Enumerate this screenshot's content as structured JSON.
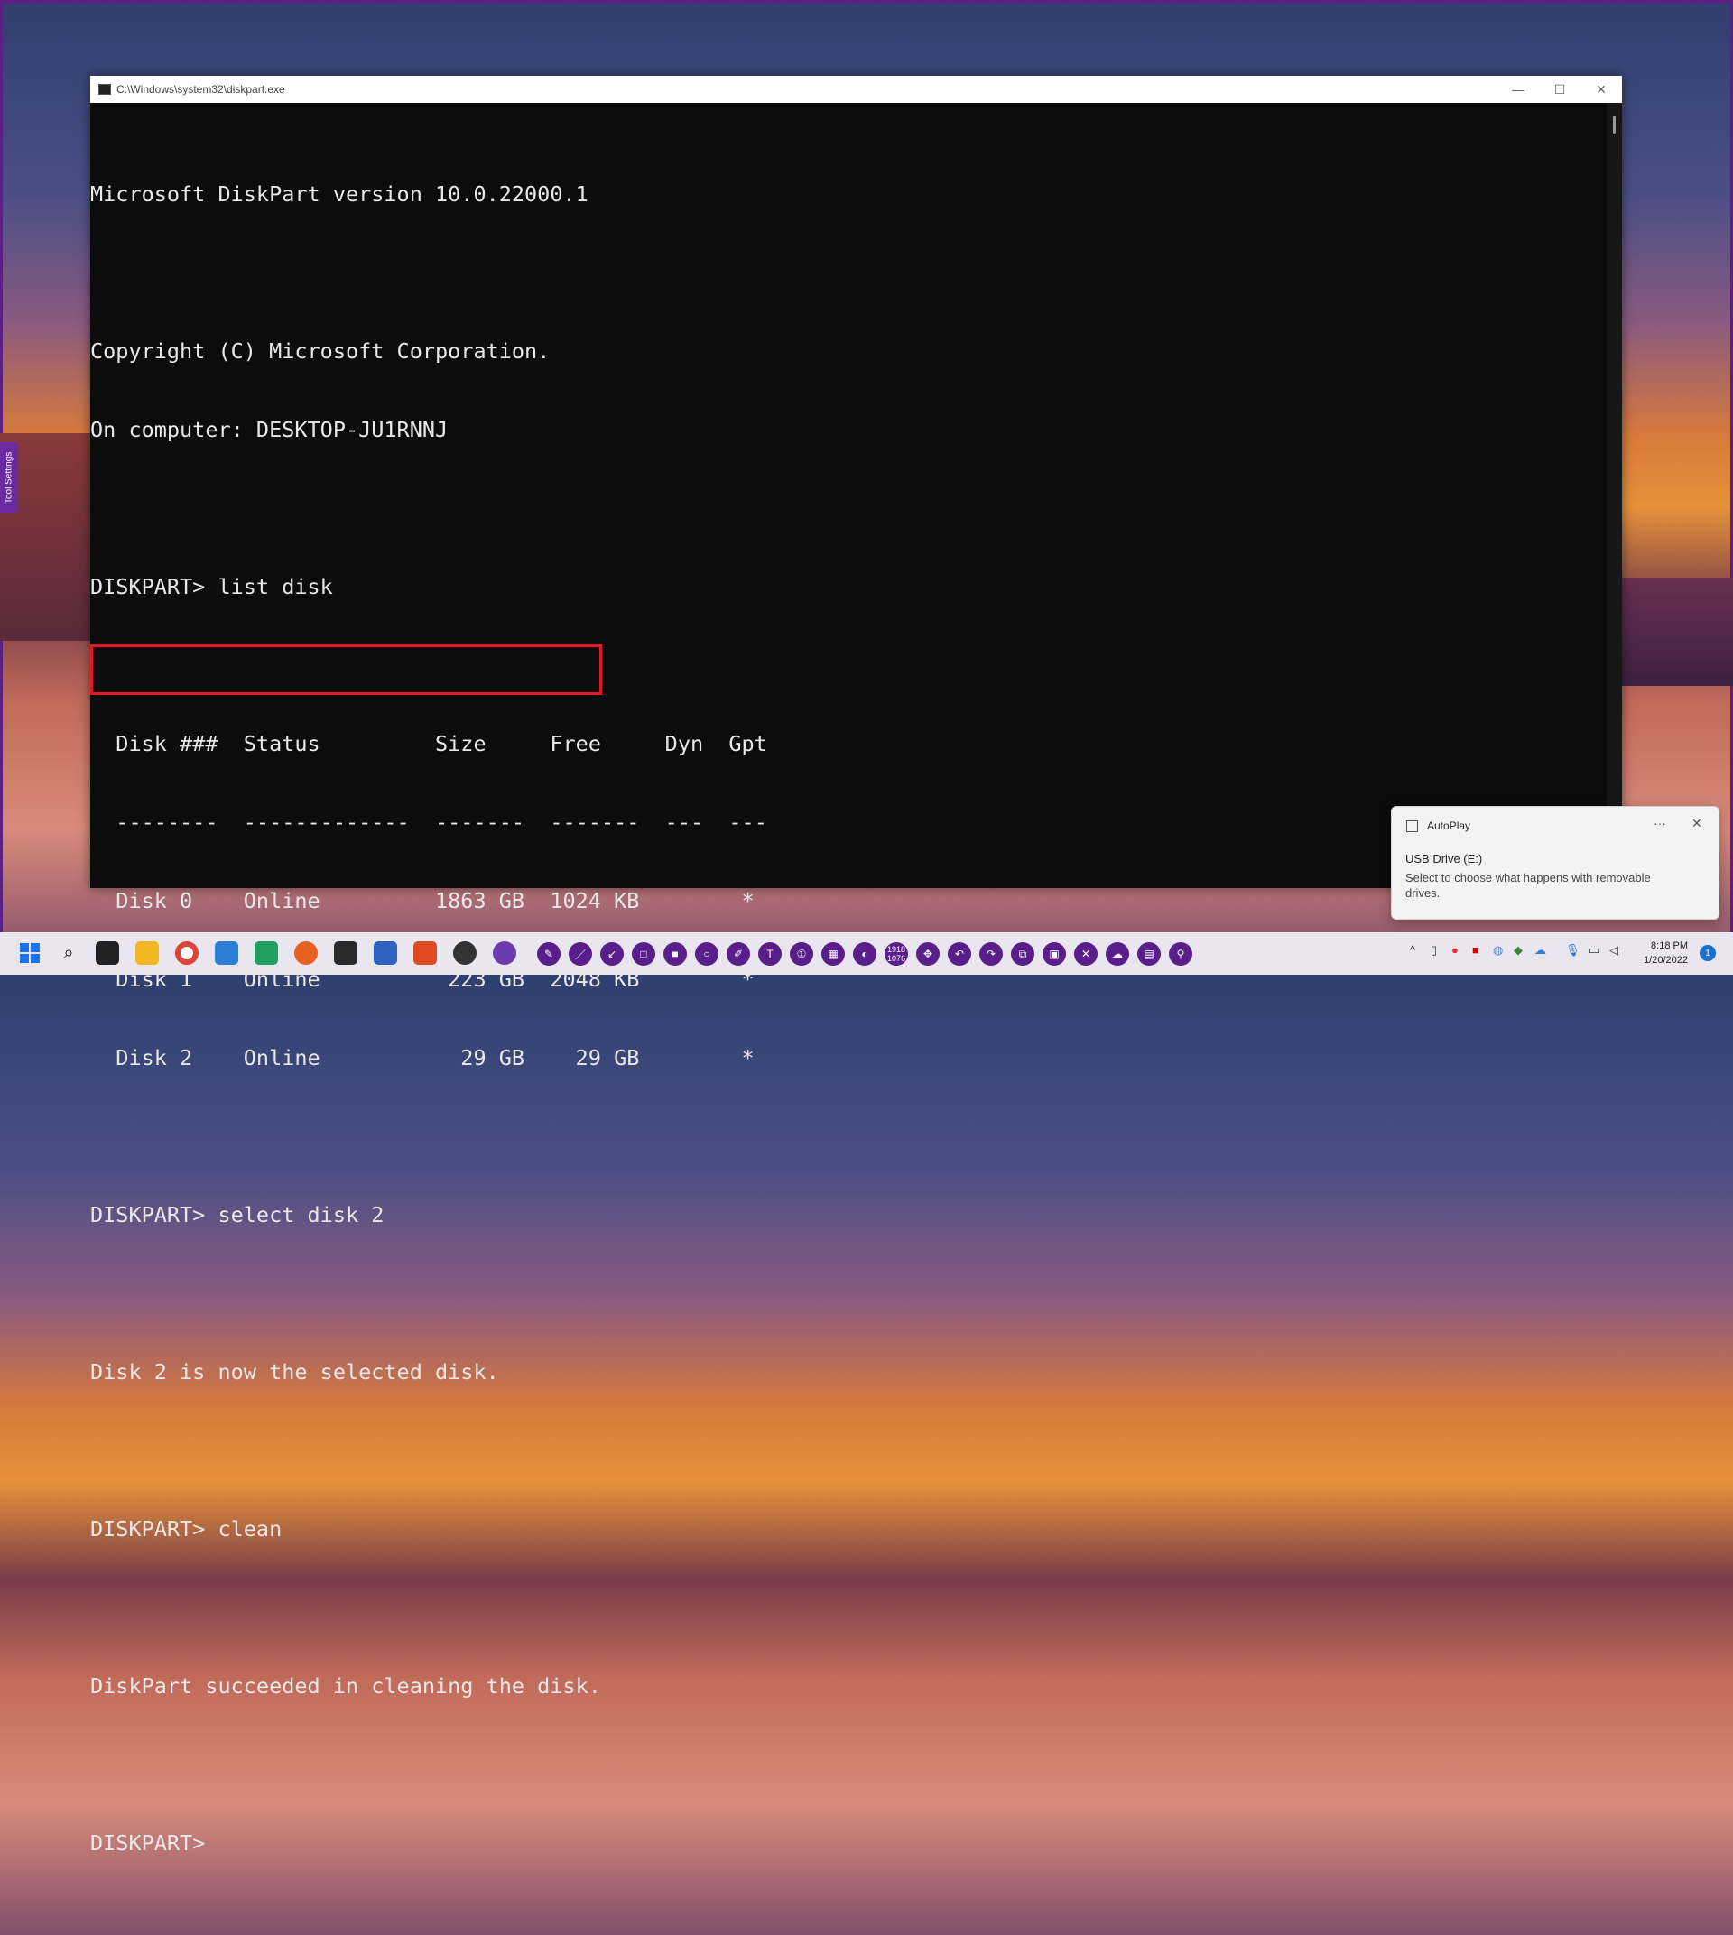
{
  "window": {
    "title": "C:\\Windows\\system32\\diskpart.exe",
    "minimize": "—",
    "maximize": "☐",
    "close": "✕"
  },
  "console": {
    "lines": [
      "Microsoft DiskPart version 10.0.22000.1",
      "",
      "Copyright (C) Microsoft Corporation.",
      "On computer: DESKTOP-JU1RNNJ",
      "",
      "DISKPART> list disk",
      "",
      "  Disk ###  Status         Size     Free     Dyn  Gpt",
      "  --------  -------------  -------  -------  ---  ---",
      "  Disk 0    Online         1863 GB  1024 KB        *",
      "  Disk 1    Online          223 GB  2048 KB        *",
      "  Disk 2    Online           29 GB    29 GB        *",
      "",
      "DISKPART> select disk 2",
      "",
      "Disk 2 is now the selected disk.",
      "",
      "DISKPART> clean",
      "",
      "DiskPart succeeded in cleaning the disk.",
      "",
      "DISKPART> "
    ]
  },
  "side_panel": {
    "label": "Tool Settings"
  },
  "toast": {
    "app": "AutoPlay",
    "more": "···",
    "close": "✕",
    "title": "USB Drive (E:)",
    "body": "Select to choose what happens with removable drives."
  },
  "taskbar": {
    "time": "8:18 PM",
    "date": "1/20/2022",
    "notifications": "1",
    "coords_x": "1918",
    "coords_y": "1076",
    "accent": "#5a1e8a"
  }
}
